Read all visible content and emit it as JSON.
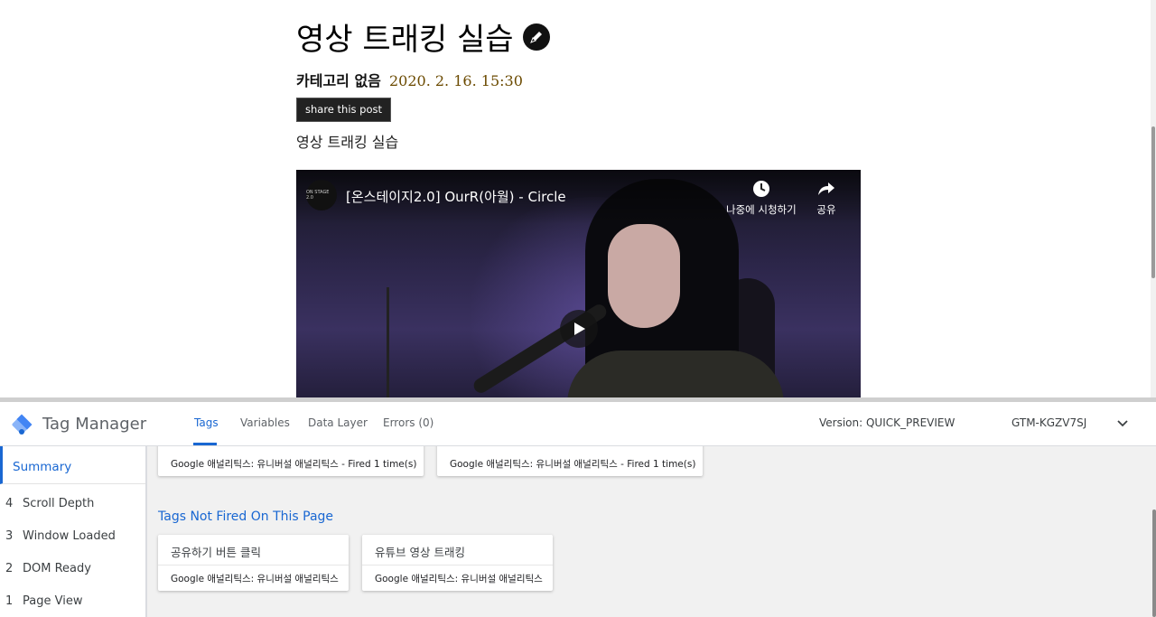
{
  "post": {
    "title": "영상 트래킹 실습",
    "category": "카테고리 없음",
    "date": "2020. 2. 16. 15:30",
    "share_label": "share this post",
    "body": "영상 트래킹 실습"
  },
  "video": {
    "channel_logo_text": "ON STAGE 2.0",
    "title": "[온스테이지2.0] OurR(아월) - Circle",
    "watch_later_label": "나중에 시청하기",
    "share_label": "공유"
  },
  "gtm": {
    "brand": "Tag Manager",
    "tabs": [
      {
        "label": "Tags"
      },
      {
        "label": "Variables"
      },
      {
        "label": "Data Layer"
      },
      {
        "label": "Errors (0)"
      }
    ],
    "version": "Version: QUICK_PREVIEW",
    "container_id": "GTM-KGZV7SJ",
    "sidebar": {
      "summary_label": "Summary",
      "events": [
        {
          "num": "4",
          "label": "Scroll Depth"
        },
        {
          "num": "3",
          "label": "Window Loaded"
        },
        {
          "num": "2",
          "label": "DOM Ready"
        },
        {
          "num": "1",
          "label": "Page View"
        }
      ]
    },
    "fired_tags": [
      {
        "subtitle": "Google 애널리틱스: 유니버설 애널리틱스 - Fired 1 time(s)"
      },
      {
        "subtitle": "Google 애널리틱스: 유니버설 애널리틱스 - Fired 1 time(s)"
      }
    ],
    "not_fired_title": "Tags Not Fired On This Page",
    "not_fired_tags": [
      {
        "name": "공유하기 버튼 클릭",
        "subtitle": "Google 애널리틱스: 유니버설 애널리틱스"
      },
      {
        "name": "유튜브 영상 트래킹",
        "subtitle": "Google 애널리틱스: 유니버설 애널리틱스"
      }
    ]
  },
  "colors": {
    "gtm_accent": "#1967d2",
    "gtm_logo_blue": "#4285f4",
    "gtm_logo_light": "#8ab4f8"
  },
  "icons": {
    "title_badge": "pencil-icon",
    "watch_later": "clock-icon",
    "share": "share-arrow-icon",
    "play": "play-icon",
    "gtm_logo": "tag-manager-logo-icon",
    "container_menu": "chevron-down-icon"
  }
}
